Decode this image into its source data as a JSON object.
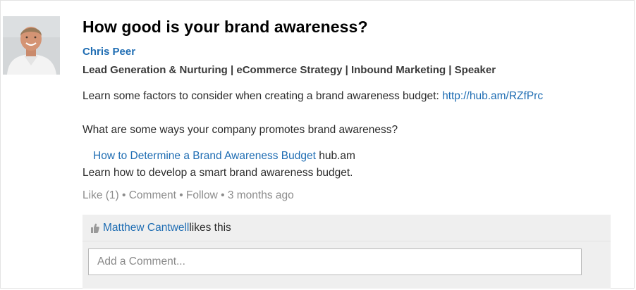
{
  "post": {
    "title": "How good is your brand awareness?",
    "author_name": "Chris Peer",
    "author_headline": "Lead Generation & Nurturing | eCommerce Strategy | Inbound Marketing | Speaker",
    "body_text": "Learn some factors to consider when creating a brand awareness budget: ",
    "body_link": "http://hub.am/RZfPrc",
    "question": "What are some ways your company promotes brand awareness?",
    "shared_link_title": "How to Determine a Brand Awareness Budget",
    "shared_link_source": " hub.am",
    "shared_link_description": "Learn how to develop a smart brand awareness budget."
  },
  "actions": {
    "like": "Like (1)",
    "sep1": " • ",
    "comment": "Comment",
    "sep2": " • ",
    "follow": "Follow",
    "sep3": " • ",
    "timestamp": "3 months ago"
  },
  "likes": {
    "icon": "thumbs-up-icon",
    "liker_name": "Matthew Cantwell",
    "suffix": " likes this"
  },
  "comment_box": {
    "placeholder": "Add a Comment..."
  },
  "colors": {
    "link": "#1f6db3",
    "muted": "#8c8c8c",
    "likes_bg": "#efefef"
  }
}
